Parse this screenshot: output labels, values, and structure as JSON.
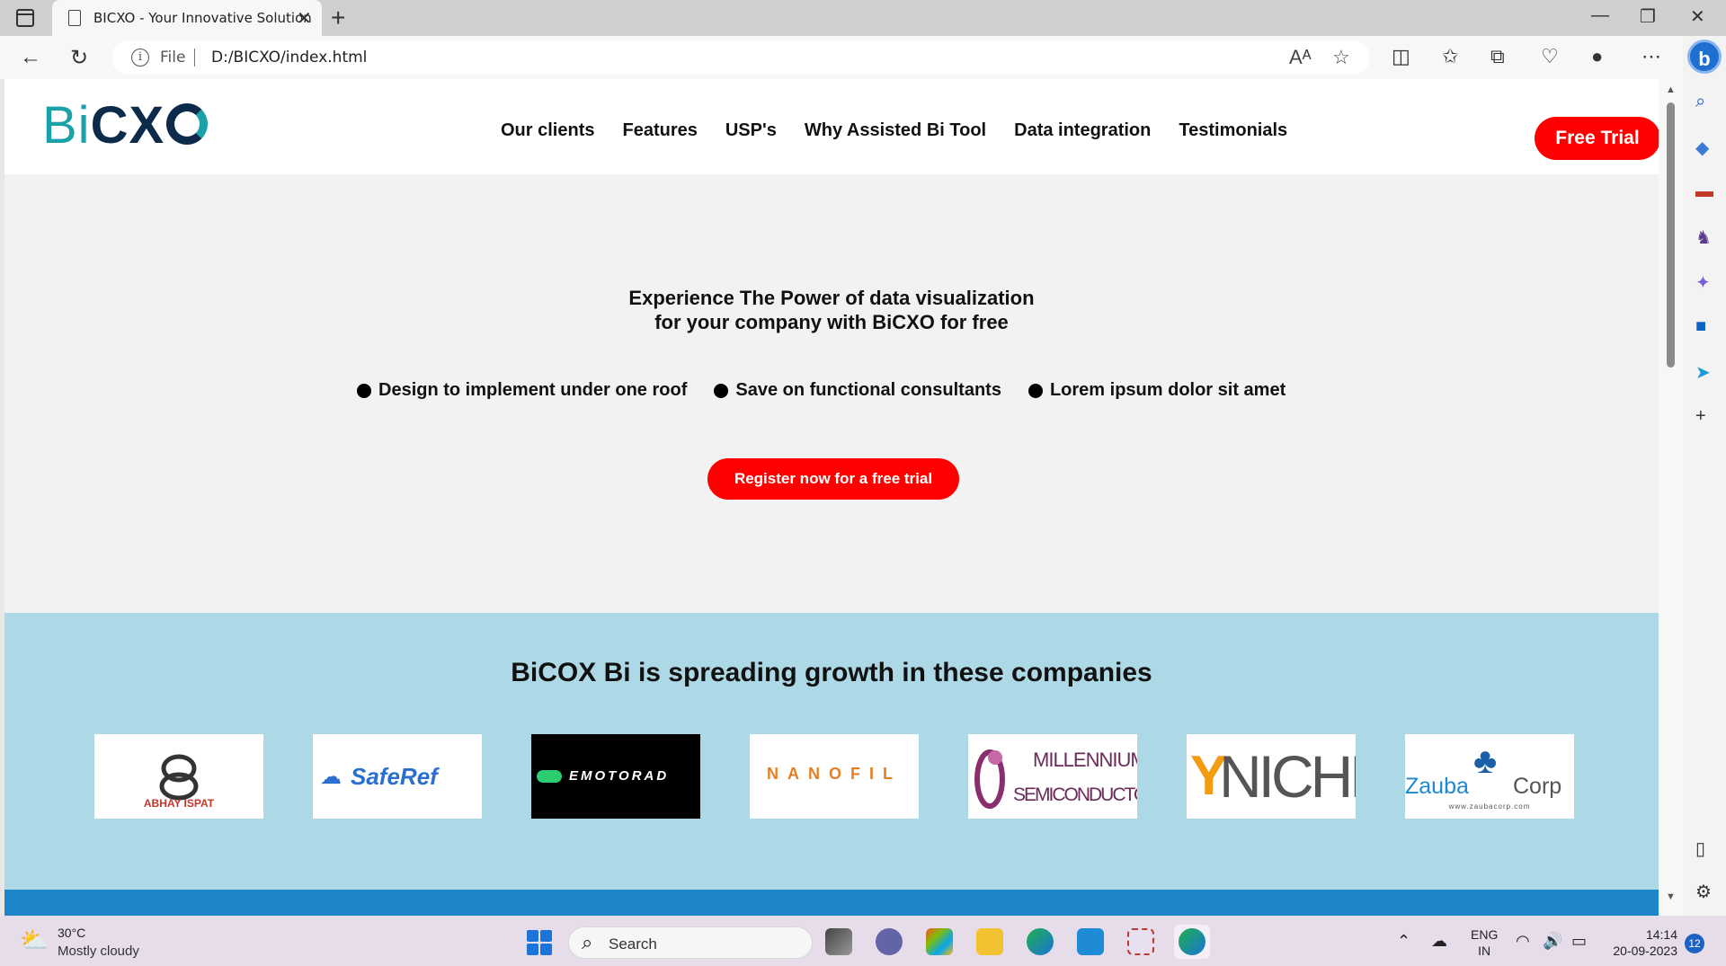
{
  "browser": {
    "tab_title": "BICXO - Your Innovative Solution",
    "address_prefix": "File",
    "address_url": "D:/BICXO/index.html"
  },
  "site": {
    "logo_bi": "Bi",
    "logo_cx": "CX",
    "nav": [
      "Our clients",
      "Features",
      "USP's",
      "Why Assisted Bi Tool",
      "Data integration",
      "Testimonials"
    ],
    "free_trial_label": "Free Trial",
    "hero_line1": "Experience The Power of data visualization",
    "hero_line2": "for your company with BiCXO for free",
    "bullets": [
      "Design to implement under one roof",
      "Save on functional consultants",
      "Lorem ipsum dolor sit amet"
    ],
    "register_label": "Register now for a free trial",
    "clients_title": "BiCOX Bi is spreading growth in these companies",
    "client_logos": [
      {
        "name": "ABHAY ISPAT"
      },
      {
        "name": "SafeRef"
      },
      {
        "name": "EMOTORAD"
      },
      {
        "name": "NANOFIL"
      },
      {
        "name": "MILLENNIUM",
        "sub": "SEMICONDUCTORS"
      },
      {
        "name": "NICHEM"
      },
      {
        "name": "Zauba",
        "sub": "Corp",
        "url": "www.zaubacorp.com"
      }
    ]
  },
  "taskbar": {
    "temperature": "30°C",
    "weather": "Mostly cloudy",
    "search_placeholder": "Search",
    "lang_top": "ENG",
    "lang_bottom": "IN",
    "time": "14:14",
    "date": "20-09-2023",
    "notifications": "12"
  },
  "colors": {
    "accent_red": "#ff0000",
    "clients_bg": "#add8e6",
    "band_blue": "#1e86c8",
    "logo_teal": "#1ba2a8",
    "logo_navy": "#0c2b4b"
  }
}
